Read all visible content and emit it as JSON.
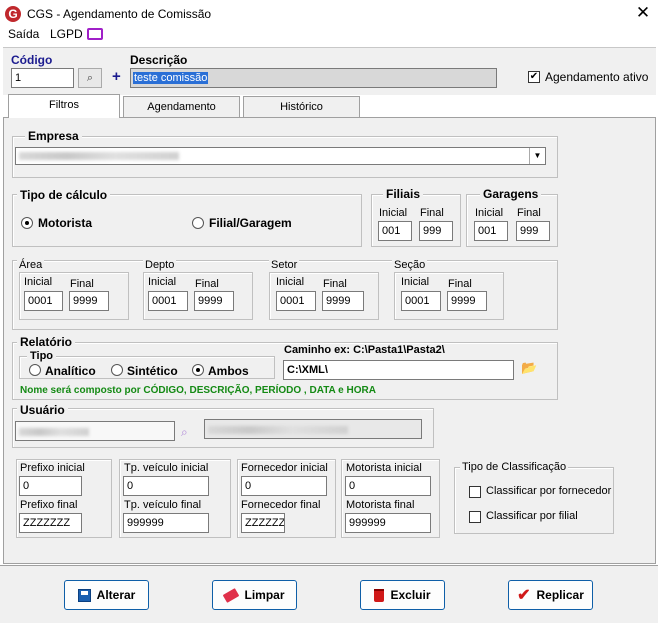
{
  "window": {
    "title": "CGS - Agendamento de Comissão",
    "app_icon": "G"
  },
  "menu": {
    "items": [
      "Saída",
      "LGPD"
    ]
  },
  "header": {
    "codigo_label": "Código",
    "codigo_value": "1",
    "descricao_label": "Descrição",
    "descricao_value": "teste comissão",
    "agendamento_ativo_label": "Agendamento ativo",
    "agendamento_ativo_checked": true
  },
  "tabs": [
    "Filtros",
    "Agendamento",
    "Histórico"
  ],
  "empresa": {
    "title": "Empresa"
  },
  "tipo_calculo": {
    "title": "Tipo de cálculo",
    "options": [
      "Motorista",
      "Filial/Garagem"
    ],
    "selected": "Motorista"
  },
  "filiais": {
    "title": "Filiais",
    "inicial_label": "Inicial",
    "final_label": "Final",
    "inicial": "001",
    "final": "999"
  },
  "garagens": {
    "title": "Garagens",
    "inicial_label": "Inicial",
    "final_label": "Final",
    "inicial": "001",
    "final": "999"
  },
  "ranges": [
    {
      "title": "Área",
      "inicial_label": "Inicial",
      "final_label": "Final",
      "inicial": "0001",
      "final": "9999"
    },
    {
      "title": "Depto",
      "inicial_label": "Inicial",
      "final_label": "Final",
      "inicial": "0001",
      "final": "9999"
    },
    {
      "title": "Setor",
      "inicial_label": "Inicial",
      "final_label": "Final",
      "inicial": "0001",
      "final": "9999"
    },
    {
      "title": "Seção",
      "inicial_label": "Inicial",
      "final_label": "Final",
      "inicial": "0001",
      "final": "9999"
    }
  ],
  "relatorio": {
    "title": "Relatório",
    "tipo_label": "Tipo",
    "options": [
      "Analítico",
      "Sintético",
      "Ambos"
    ],
    "selected": "Ambos",
    "caminho_label": "Caminho ex: C:\\Pasta1\\Pasta2\\",
    "caminho_value": "C:\\XML\\",
    "note": "Nome será composto por CÓDIGO,  DESCRIÇÃO, PERÍODO , DATA e HORA"
  },
  "usuario": {
    "title": "Usuário"
  },
  "filters": [
    {
      "inicial_label": "Prefixo inicial",
      "inicial": "0",
      "final_label": "Prefixo final",
      "final": "ZZZZZZZ"
    },
    {
      "inicial_label": "Tp. veículo inicial",
      "inicial": "0",
      "final_label": "Tp. veículo final",
      "final": "999999"
    },
    {
      "inicial_label": "Fornecedor inicial",
      "inicial": "0",
      "final_label": "Fornecedor final",
      "final": "ZZZZZZ"
    },
    {
      "inicial_label": "Motorista inicial",
      "inicial": "0",
      "final_label": "Motorista final",
      "final": "999999"
    }
  ],
  "classificacao": {
    "title": "Tipo de Classificação",
    "options": [
      "Classificar por fornecedor",
      "Classificar por filial"
    ]
  },
  "buttons": {
    "alterar": "Alterar",
    "limpar": "Limpar",
    "excluir": "Excluir",
    "replicar": "Replicar"
  },
  "colors": {
    "accent": "#0f5fa8",
    "selection": "#2a6fd6",
    "label_blue": "#1b1b8f",
    "note_green": "#148a14",
    "brand_red": "#c0282d"
  }
}
